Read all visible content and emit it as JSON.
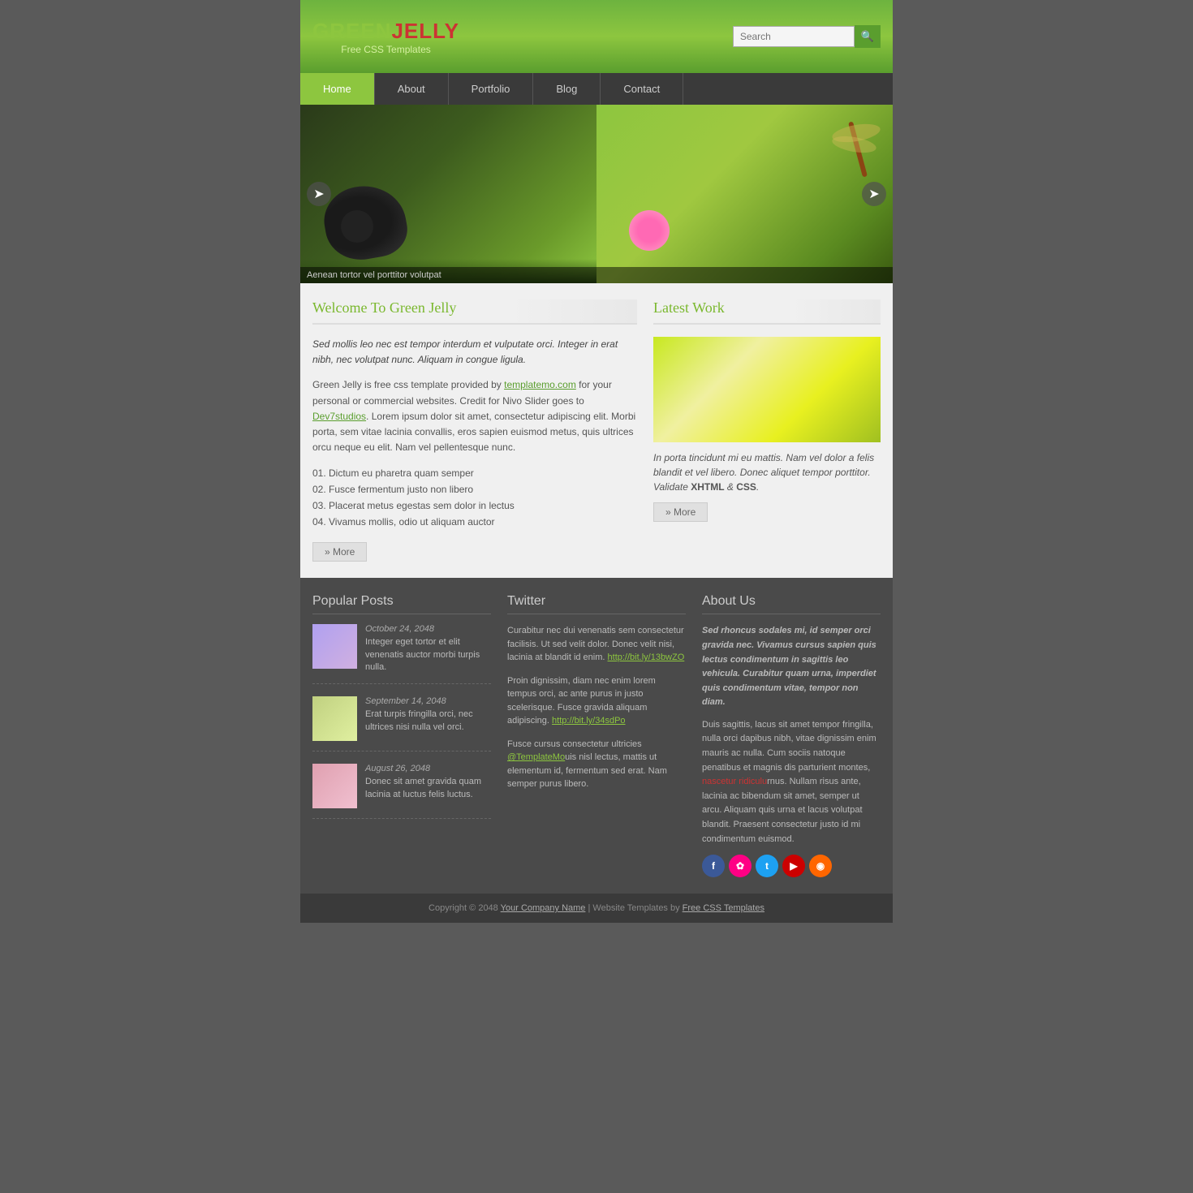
{
  "header": {
    "logo_green": "GREEN",
    "logo_red": "JELLY",
    "logo_subtitle": "Free CSS Templates",
    "search_placeholder": "Search",
    "search_button_label": "→"
  },
  "nav": {
    "items": [
      {
        "label": "Home",
        "active": true
      },
      {
        "label": "About",
        "active": false
      },
      {
        "label": "Portfolio",
        "active": false
      },
      {
        "label": "Blog",
        "active": false
      },
      {
        "label": "Contact",
        "active": false
      }
    ]
  },
  "slider": {
    "caption": "Aenean tortor vel porttitor volutpat"
  },
  "welcome": {
    "title": "Welcome To Green Jelly",
    "intro": "Sed mollis leo nec est tempor interdum et vulputate orci. Integer in erat nibh, nec volutpat nunc. Aliquam in congue ligula.",
    "body1": "Green Jelly is free css template provided by ",
    "link1": "templatemo.com",
    "body2": " for your personal or commercial websites. Credit for Nivo Slider goes to ",
    "link2": "Dev7studios",
    "body3": ". Lorem ipsum dolor sit amet, consectetur adipiscing elit. Morbi porta, sem vitae lacinia convallis, eros sapien euismod metus, quis ultrices orcu neque eu elit. Nam vel pellentesque nunc.",
    "list": [
      "01.  Dictum eu pharetra quam semper",
      "02.  Fusce fermentum justo non libero",
      "03.  Placerat metus egestas sem dolor in lectus",
      "04.  Vivamus mollis, odio ut aliquam auctor"
    ],
    "more_label": "» More"
  },
  "latest_work": {
    "title": "Latest Work",
    "caption": "In porta tincidunt mi eu mattis. Nam vel dolor a felis blandit et vel libero. Donec aliquet tempor porttitor. Validate ",
    "xhtml": "XHTML",
    "and": " & ",
    "css": "CSS",
    "period": ".",
    "more_label": "» More"
  },
  "popular_posts": {
    "title": "Popular Posts",
    "posts": [
      {
        "date": "October 24, 2048",
        "text": "Integer eget tortor et elit venenatis auctor morbi turpis nulla.",
        "thumb_color": "purple"
      },
      {
        "date": "September 14, 2048",
        "text": "Erat turpis fringilla orci, nec ultrices nisi nulla vel orci.",
        "thumb_color": "green"
      },
      {
        "date": "August 26, 2048",
        "text": "Donec sit amet gravida quam lacinia at luctus felis luctus.",
        "thumb_color": "pink"
      }
    ]
  },
  "twitter": {
    "title": "Twitter",
    "tweets": [
      {
        "text": "Curabitur nec dui venenatis sem consectetur facilisis. Ut sed velit dolor. Donec velit nisi, lacinia at blandit id enim. ",
        "link_text": "http://bit.ly/13bwZO",
        "link_href": "http://bit.ly/13bwZO"
      },
      {
        "text": "Proin dignissim, diam nec enim lorem tempus orci, ac ante purus in justo scelerisque. Fusce gravida aliquam adipiscing. ",
        "link_text": "http://bit.ly/34sdPo",
        "link_href": "http://bit.ly/34sdPo"
      },
      {
        "text": "Fusce cursus consectetur ultricies ",
        "link_text": "@TemplateMo",
        "link_href": "#",
        "text2": "uis nisl lectus, mattis ut elementum id, fermentum sed erat. Nam semper purus libero."
      }
    ]
  },
  "about_us": {
    "title": "About Us",
    "para1": "Sed rhoncus sodales mi, id semper orci gravida nec. Vivamus cursus sapien quis lectus condimentum in sagittis leo vehicula. Curabitur quam urna, imperdiet quis condimentum vitae, tempor non diam.",
    "para2": "Duis sagittis, lacus sit amet tempor fringilla, nulla orci dapibus nibh, vitae dignissim enim mauris ac nulla. Cum sociis natoque penatibus et magnis dis parturient montes, ",
    "highlight": "nascetur ridiculu",
    "para2b": "rnus. Nullam risus ante, lacinia ac bibendum sit amet, semper ut arcu. Aliquam quis urna et lacus volutpat blandit. Praesent consectetur justo id mi condimentum euismod.",
    "social": [
      {
        "name": "facebook",
        "label": "f",
        "class": "social-fb"
      },
      {
        "name": "flickr",
        "label": "✿",
        "class": "social-flickr"
      },
      {
        "name": "twitter",
        "label": "t",
        "class": "social-tw"
      },
      {
        "name": "youtube",
        "label": "▶",
        "class": "social-yt"
      },
      {
        "name": "rss",
        "label": "◉",
        "class": "social-rss"
      }
    ]
  },
  "footer": {
    "copyright": "Copyright © 2048 ",
    "company_link": "Your Company Name",
    "separator": " | ",
    "templates_text": "Website Templates by ",
    "templates_link": "Free CSS Templates"
  }
}
